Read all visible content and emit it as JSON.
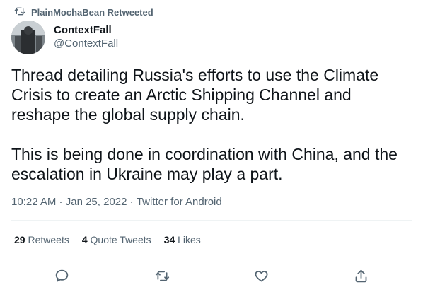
{
  "social_context": {
    "text": "PlainMochaBean Retweeted",
    "icon": "retweet-icon"
  },
  "author": {
    "display_name": "ContextFall",
    "handle": "@ContextFall"
  },
  "tweet": {
    "paragraph_1": "Thread detailing Russia's efforts to use the Climate Crisis to create an Arctic Shipping Channel and reshape the global supply chain.",
    "paragraph_2": "This is being done in coordination with China, and the escalation in Ukraine may play a part."
  },
  "meta": {
    "time": "10:22 AM",
    "separator": " · ",
    "date": "Jan 25, 2022",
    "source": "Twitter for Android"
  },
  "stats": {
    "retweets_count": "29",
    "retweets_label": "Retweets",
    "quote_count": "4",
    "quote_label": "Quote Tweets",
    "likes_count": "34",
    "likes_label": "Likes"
  },
  "actions": [
    {
      "name": "reply",
      "icon": "reply-icon"
    },
    {
      "name": "retweet",
      "icon": "retweet-icon"
    },
    {
      "name": "like",
      "icon": "heart-icon"
    },
    {
      "name": "share",
      "icon": "share-icon"
    }
  ],
  "colors": {
    "text": "#0f1419",
    "secondary": "#536471",
    "divider": "#eff3f4"
  }
}
